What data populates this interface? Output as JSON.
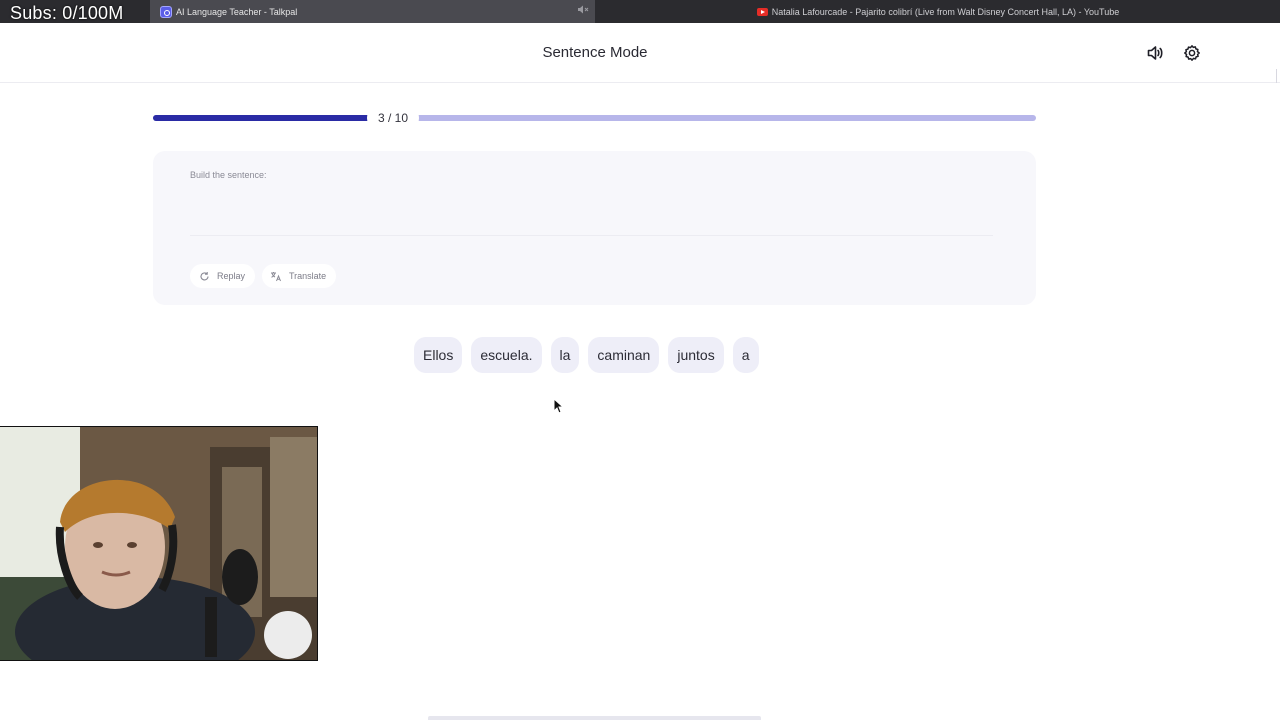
{
  "overlay": {
    "subs_text": "Subs: 0/100M"
  },
  "browser_tabs": [
    {
      "title": "AI Language Teacher - Talkpal",
      "icon": "talkpal-icon",
      "muted_icon": "speaker-muted-icon"
    },
    {
      "title": "Natalia Lafourcade - Pajarito colibrí (Live from Walt Disney Concert Hall, LA) - YouTube",
      "icon": "youtube-icon"
    }
  ],
  "header": {
    "title": "Sentence Mode",
    "sound_icon": "speaker-icon",
    "settings_icon": "gear-icon"
  },
  "progress": {
    "current": 3,
    "total": 10,
    "label": "3 / 10",
    "fraction": 0.3
  },
  "card": {
    "prompt": "Build the sentence:",
    "answer": "",
    "replay_label": "Replay",
    "translate_label": "Translate"
  },
  "word_bank": [
    "Ellos",
    "escuela.",
    "la",
    "caminan",
    "juntos",
    "a"
  ],
  "colors": {
    "progress_fill": "#2a2ba5",
    "progress_track": "#b7b6ea",
    "chip_bg": "#eeeef8",
    "card_bg": "#f7f7fb"
  }
}
